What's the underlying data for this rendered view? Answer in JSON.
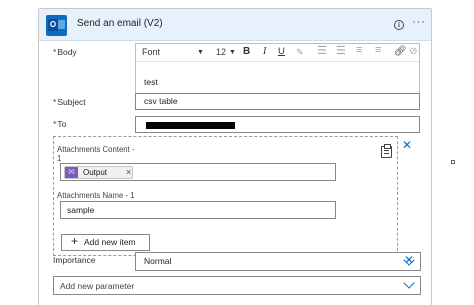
{
  "card": {
    "title": "Send an email (V2)",
    "more": "···"
  },
  "body": {
    "label": "Body",
    "required_mark": "*",
    "font_name": "Font",
    "font_size": "12",
    "bold": "B",
    "italic": "I",
    "underline": "U",
    "text": "test"
  },
  "subject": {
    "label": "Subject",
    "required_mark": "*",
    "value": "csv table"
  },
  "to": {
    "label": "To",
    "required_mark": "*"
  },
  "attachments": {
    "content_label": "Attachments Content -\n1",
    "token_label": "Output",
    "token_icon": "{x}",
    "name_label": "Attachments Name - 1",
    "name_value": "sample",
    "add_item_label": "Add new item"
  },
  "importance": {
    "label": "Importance",
    "value": "Normal"
  },
  "add_parameter": {
    "placeholder": "Add new parameter"
  },
  "colors": {
    "accent": "#0f6cbd",
    "required": "#a4262c",
    "token": "#7a5bc0",
    "header_bg": "#e7f1fb"
  }
}
